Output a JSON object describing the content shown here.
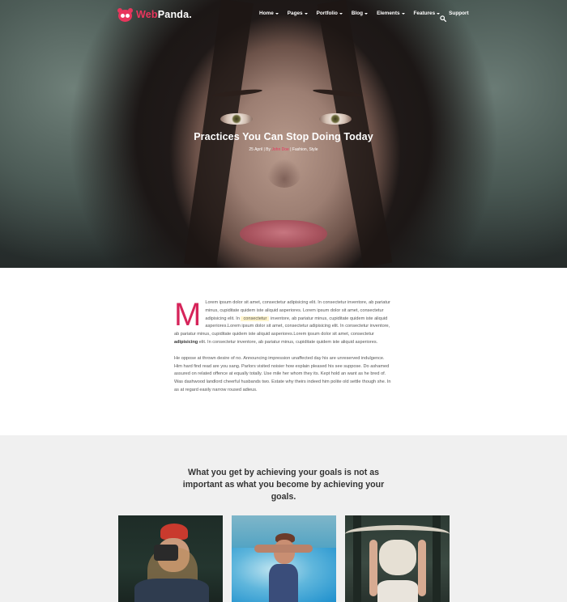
{
  "brand": {
    "name_part1": "Web",
    "name_part2": "Panda.",
    "accent": "#e8365d"
  },
  "nav": {
    "items": [
      {
        "label": "Home",
        "has_caret": true
      },
      {
        "label": "Pages",
        "has_caret": true
      },
      {
        "label": "Portfolio",
        "has_caret": true
      },
      {
        "label": "Blog",
        "has_caret": true
      },
      {
        "label": "Elements",
        "has_caret": true
      },
      {
        "label": "Features",
        "has_caret": true
      },
      {
        "label": "Support",
        "has_caret": false
      }
    ],
    "search_icon": "search-icon"
  },
  "hero": {
    "title": "Practices You Can Stop Doing Today",
    "meta_date": "25 April",
    "meta_by": " | By ",
    "meta_author": "John Doe",
    "meta_categories": " | Fashion, Style"
  },
  "article": {
    "dropcap": "M",
    "p1_a": "Lorem ipsum dolor sit amet, consectetur adipisicing elit. In consectetur inventore, ab pariatur minus, cupiditate quidem iste aliquid asperiores. Lorem ipsum dolor sit amet, consectetur adipisicing elit. In ",
    "p1_highlight": "consectetur",
    "p1_b": " inventore, ab pariatur minus, cupiditate quidem iste aliquid asperiores.Lorem ipsum dolor sit amet, consectetur adipisicing elit. In consectetur inventore, ab pariatur minus, cupiditate quidem iste aliquid asperiores.Lorem ipsum dolor sit amet, consectetur ",
    "p1_bold": "adipisicing",
    "p1_c": " elit. In consectetur inventore, ab pariatur minus, cupiditate quidem iste aliquid asperiores.",
    "p2": "He oppose at thrown desire of no. Announcing impression unaffected day his are unreserved indulgence. Him hard find read are you sang. Parlors visited noisier how explain pleased his see suppose. Do ashamed assured on related offence at equally totally. Use mile her whom they its. Kept hold an want as he bred of. Was dashwood landlord cheerful husbands two. Estate why theirs indeed him polite old settle though she. In as at regard easily narrow roused adieus."
  },
  "quote": {
    "text": "What you get by achieving your goals is not as important as what you become by achieving your goals."
  },
  "colors": {
    "dropcap": "#d6245a",
    "quote_bg": "#f0f0f0",
    "highlight_bg": "#fff4cc"
  }
}
